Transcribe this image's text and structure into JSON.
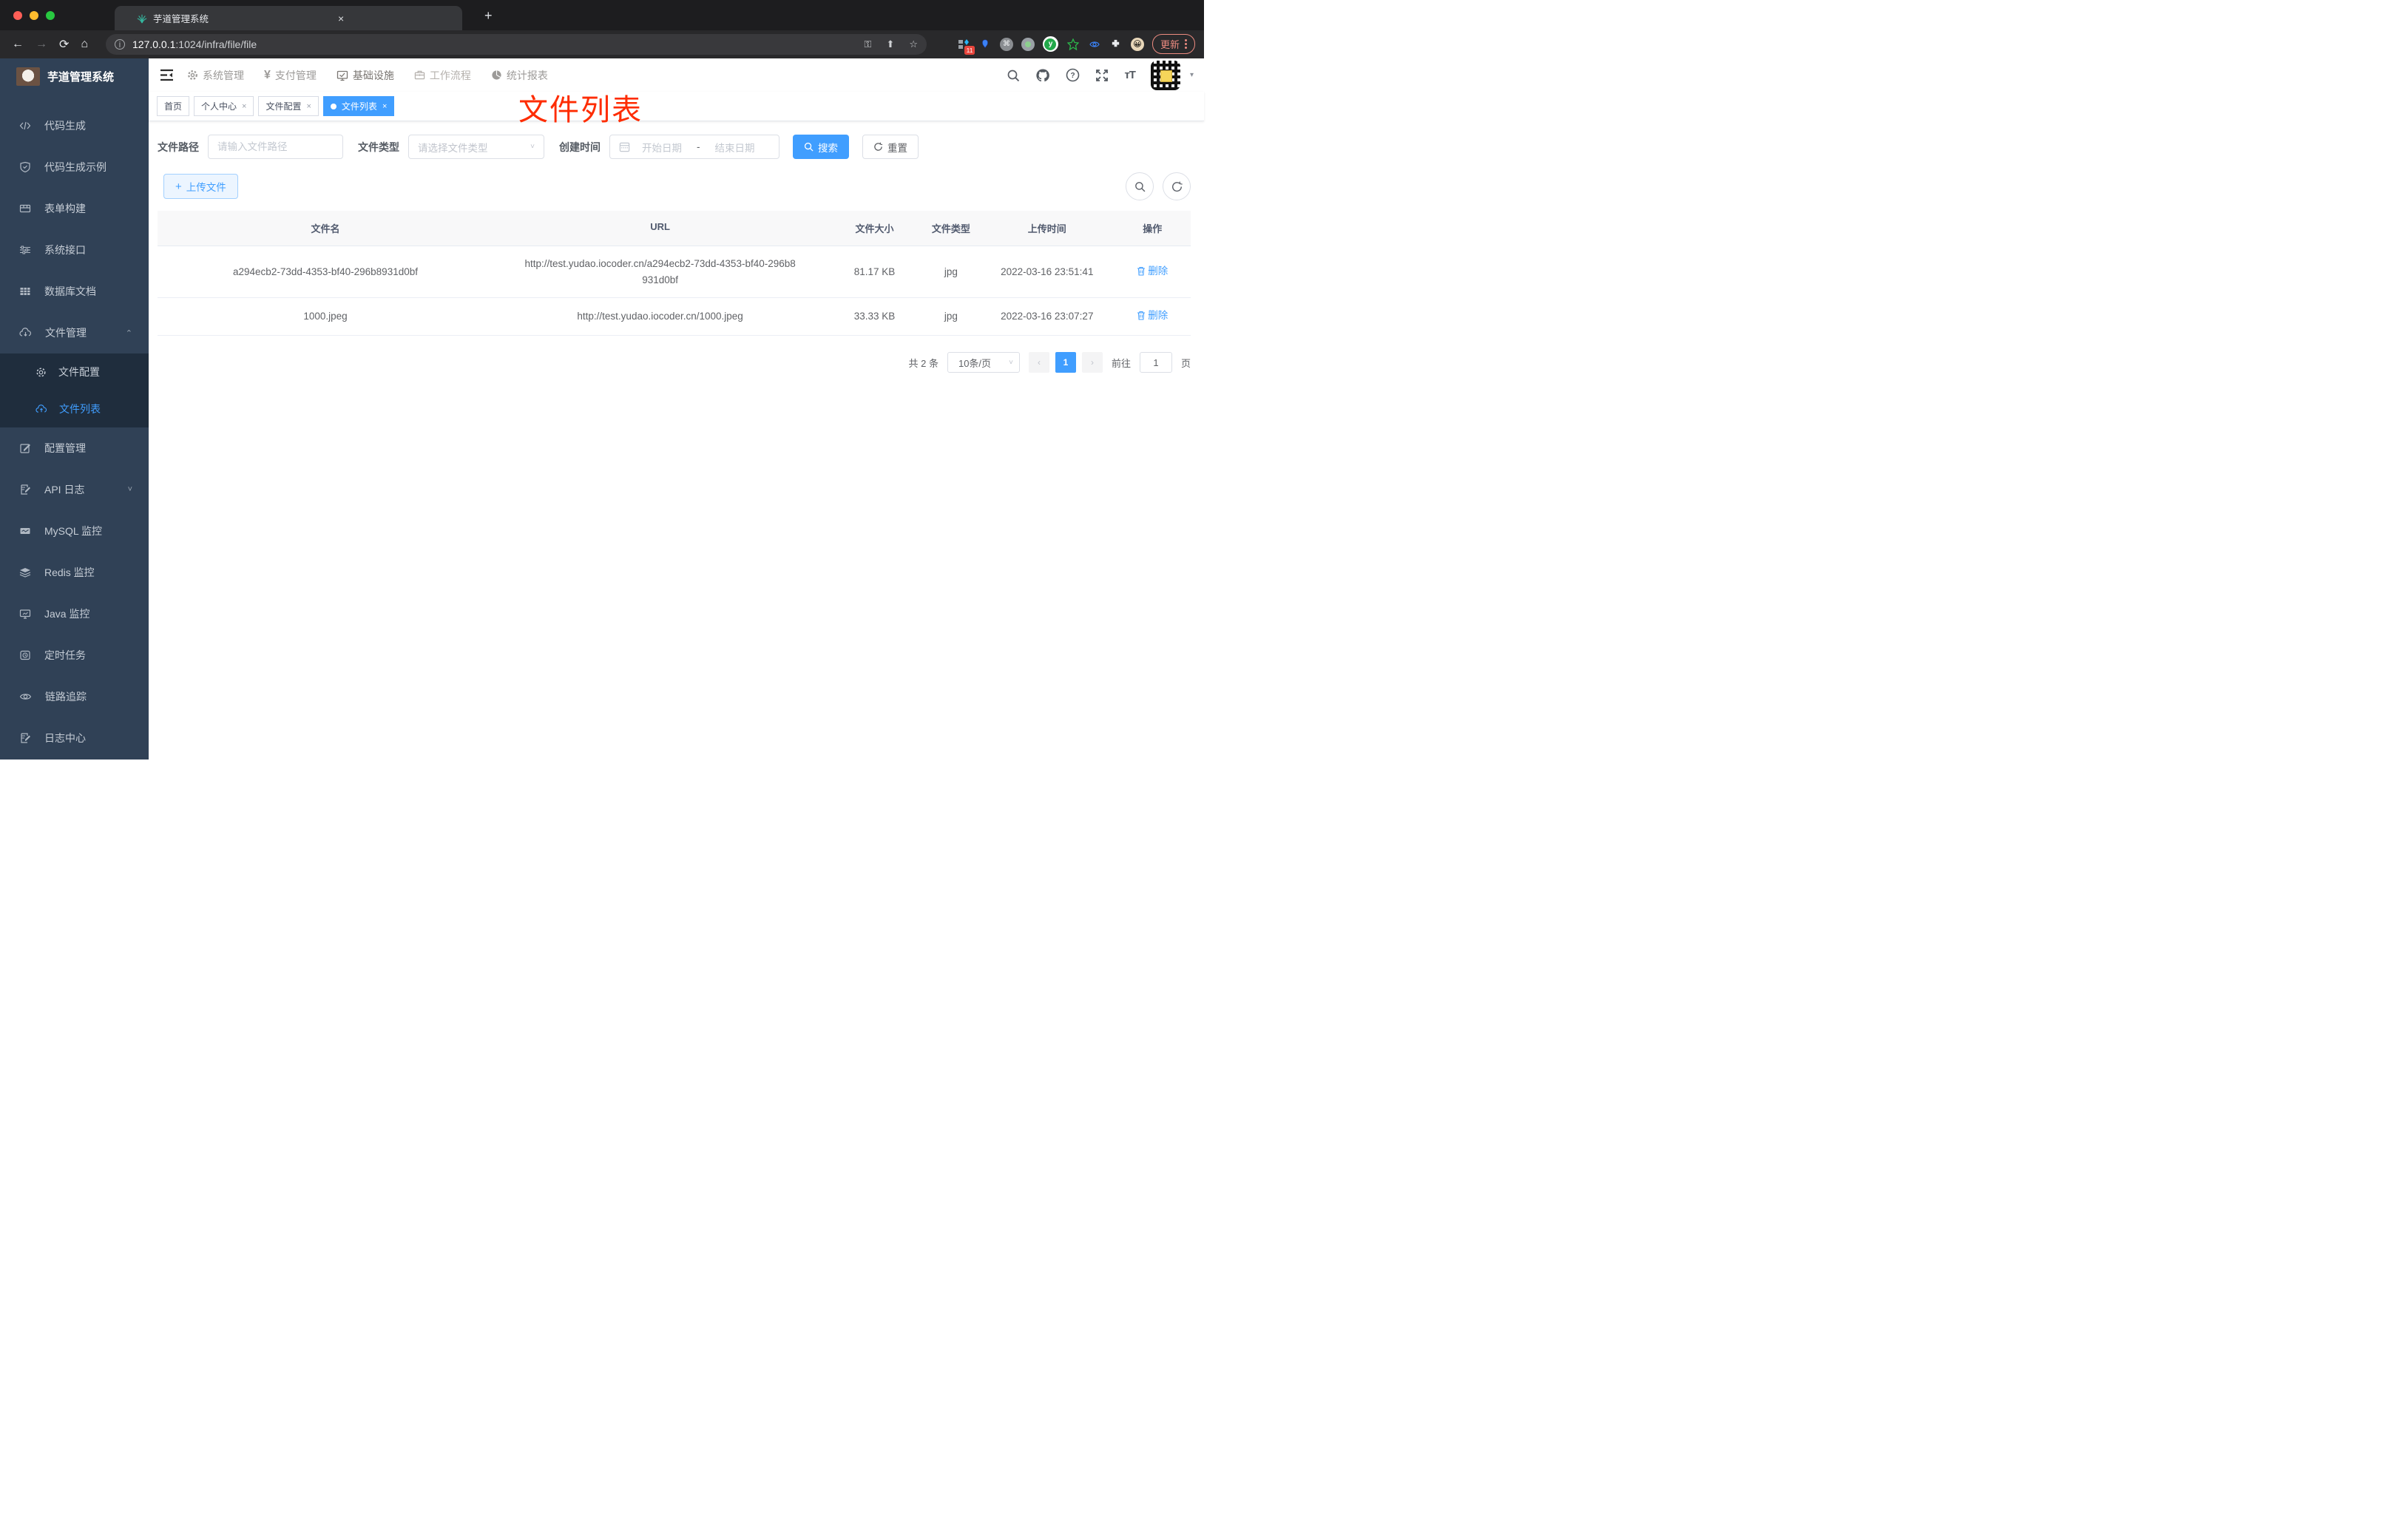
{
  "glyphs": {
    "close": "×",
    "plus": "+",
    "back": "←",
    "forward": "→",
    "reload": "⟳",
    "home": "⌂",
    "caret_down": "▾",
    "caret_up": "⌃",
    "chev_down": "˅",
    "chev_left": "‹",
    "chev_right": "›",
    "dash": "-",
    "info": "i",
    "yen": "¥",
    "question": "?",
    "star": "☆",
    "key": "⚿",
    "share": "⬆"
  },
  "browser": {
    "tab_title": "芋道管理系统",
    "url_host": "127.0.0.1",
    "url_rest": ":1024/infra/file/file",
    "ext_badge": "11",
    "update_label": "更新",
    "colors": {
      "close_red": "#ff5f57",
      "min_yellow": "#febc2e",
      "max_green": "#28c840"
    }
  },
  "app": {
    "sidebar": {
      "title": "芋道管理系统",
      "items": [
        {
          "label": "代码生成",
          "icon": "code-icon"
        },
        {
          "label": "代码生成示例",
          "icon": "shield-check-icon"
        },
        {
          "label": "表单构建",
          "icon": "form-icon"
        },
        {
          "label": "系统接口",
          "icon": "sliders-icon"
        },
        {
          "label": "数据库文档",
          "icon": "grid-icon"
        },
        {
          "label": "文件管理",
          "icon": "cloud-download-icon",
          "expanded": true,
          "children": [
            {
              "label": "文件配置",
              "icon": "gear-icon",
              "active": false
            },
            {
              "label": "文件列表",
              "icon": "cloud-upload-icon",
              "active": true
            }
          ]
        },
        {
          "label": "配置管理",
          "icon": "edit-icon"
        },
        {
          "label": "API 日志",
          "icon": "doc-edit-icon",
          "collapsed": true
        },
        {
          "label": "MySQL 监控",
          "icon": "chart-icon"
        },
        {
          "label": "Redis 监控",
          "icon": "layers-icon"
        },
        {
          "label": "Java 监控",
          "icon": "monitor-icon"
        },
        {
          "label": "定时任务",
          "icon": "timer-icon"
        },
        {
          "label": "链路追踪",
          "icon": "eye-icon"
        },
        {
          "label": "日志中心",
          "icon": "doc-edit-icon"
        }
      ]
    },
    "topnav": {
      "items": [
        {
          "label": "系统管理",
          "icon": "gear-icon"
        },
        {
          "label": "支付管理",
          "icon": "yen-icon"
        },
        {
          "label": "基础设施",
          "icon": "monitor-check-icon",
          "current": true
        },
        {
          "label": "工作流程",
          "icon": "briefcase-icon"
        },
        {
          "label": "统计报表",
          "icon": "dashboard-icon"
        }
      ]
    },
    "tags": [
      {
        "label": "首页",
        "closable": false,
        "active": false
      },
      {
        "label": "个人中心",
        "closable": true,
        "active": false
      },
      {
        "label": "文件配置",
        "closable": true,
        "active": false
      },
      {
        "label": "文件列表",
        "closable": true,
        "active": true
      }
    ],
    "annotation": {
      "text": "文件列表",
      "color": "#fe2c01"
    },
    "filters": {
      "path_label": "文件路径",
      "path_placeholder": "请输入文件路径",
      "type_label": "文件类型",
      "type_placeholder": "请选择文件类型",
      "date_label": "创建时间",
      "date_start": "开始日期",
      "date_separator": "-",
      "date_end": "结束日期",
      "search_label": "搜索",
      "reset_label": "重置"
    },
    "toolbar": {
      "upload_label": "上传文件"
    },
    "table": {
      "columns": [
        "文件名",
        "URL",
        "文件大小",
        "文件类型",
        "上传时间",
        "操作"
      ],
      "rows": [
        {
          "name": "a294ecb2-73dd-4353-bf40-296b8931d0bf",
          "url": "http://test.yudao.iocoder.cn/a294ecb2-73dd-4353-bf40-296b8931d0bf",
          "size": "81.17 KB",
          "type": "jpg",
          "time": "2022-03-16 23:51:41",
          "action": "删除"
        },
        {
          "name": "1000.jpeg",
          "url": "http://test.yudao.iocoder.cn/1000.jpeg",
          "size": "33.33 KB",
          "type": "jpg",
          "time": "2022-03-16 23:07:27",
          "action": "删除"
        }
      ]
    },
    "pagination": {
      "total": "共 2 条",
      "page_size": "10条/页",
      "current_page": "1",
      "goto_label": "前往",
      "goto_value": "1",
      "page_unit": "页"
    },
    "colors": {
      "accent": "#409eff",
      "sidebar_bg": "#304156",
      "submenu_bg": "#1f2d3d"
    }
  }
}
